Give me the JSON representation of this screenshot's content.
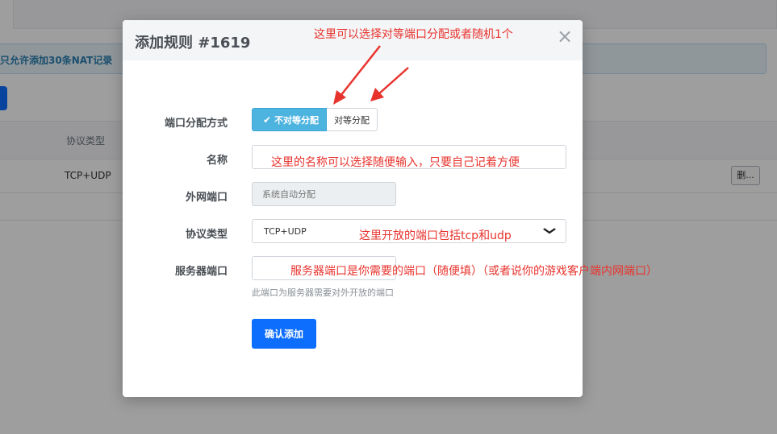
{
  "background": {
    "alert_text": "只允许添加30条NAT记录",
    "table_header_protocol": "协议类型",
    "row_protocol": "TCP+UDP",
    "row_delete_label": "删..."
  },
  "modal": {
    "title": "添加规则 #1619",
    "close_glyph": "×",
    "port_mode": {
      "label": "端口分配方式",
      "options": [
        "不对等分配",
        "对等分配"
      ],
      "selected": "不对等分配",
      "check_glyph": "✔"
    },
    "name": {
      "label": "名称",
      "value": ""
    },
    "external_port": {
      "label": "外网端口",
      "placeholder": "系统自动分配"
    },
    "protocol": {
      "label": "协议类型",
      "value": "TCP+UDP",
      "chevron_glyph": "⌄"
    },
    "server_port": {
      "label": "服务器端口",
      "value": "",
      "help": "此端口为服务器需要对外开放的端口"
    },
    "submit_label": "确认添加"
  },
  "annotations": {
    "port_mode_note": "这里可以选择对等端口分配或者随机1个",
    "name_note": "这里的名称可以选择随便输入，只要自己记着方便",
    "protocol_note": "这里开放的端口包括tcp和udp",
    "server_port_note": "服务器端口是你需要的端口（随便填）（或者说你的游戏客户端内网端口）"
  },
  "colors": {
    "primary": "#0d6efd",
    "active_segment": "#4db3df",
    "annotation": "#e8332d"
  }
}
